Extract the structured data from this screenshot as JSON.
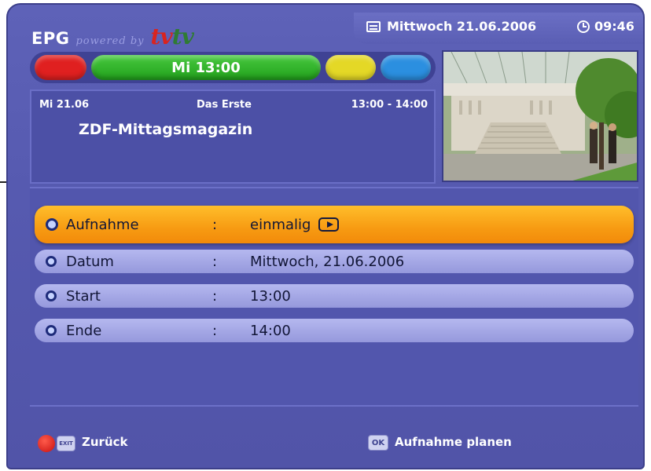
{
  "header": {
    "logo_epg": "EPG",
    "logo_powered": "powered by",
    "logo_tv1": "tv",
    "logo_tv2": "tv",
    "date": "Mittwoch 21.06.2006",
    "time": "09:46"
  },
  "colorbar": {
    "green_label": "Mi 13:00"
  },
  "program": {
    "date": "Mi 21.06",
    "channel": "Das Erste",
    "time_range": "13:00 - 14:00",
    "title": "ZDF-Mittagsmagazin"
  },
  "settings": {
    "separator": ":",
    "rows": [
      {
        "label": "Aufnahme",
        "value": "einmalig"
      },
      {
        "label": "Datum",
        "value": "Mittwoch, 21.06.2006"
      },
      {
        "label": "Start",
        "value": "13:00"
      },
      {
        "label": "Ende",
        "value": "14:00"
      }
    ]
  },
  "footer": {
    "exit_key": "EXIT",
    "back_label": "Zurück",
    "ok_key": "OK",
    "plan_label": "Aufnahme planen"
  },
  "colors": {
    "background": "#5a5eb4",
    "selected_row": "#f79b12",
    "row": "#a5a8e6",
    "red": "#e02020",
    "green": "#2cb126",
    "yellow": "#e4d826",
    "blue": "#2b8fe0"
  }
}
